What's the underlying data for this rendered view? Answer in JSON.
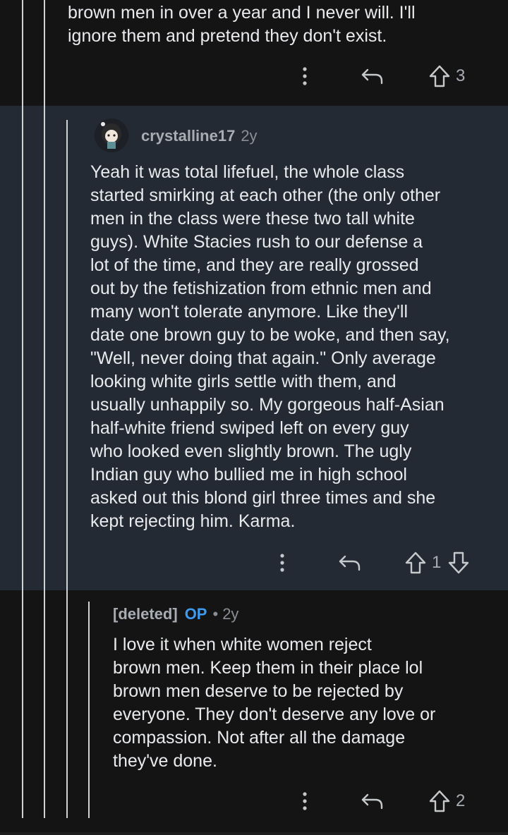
{
  "comment_top": {
    "text_partial": "brown men in over a year and I never will. I'll\nignore them and pretend they don't exist.",
    "upvotes": "3"
  },
  "comment_reply": {
    "username": "crystalline17",
    "time": "2y",
    "text": "Yeah it was total lifefuel, the whole class\nstarted smirking at each other (the only other\nmen in the class were these two tall white\nguys). White Stacies rush to our defense a\nlot of the time, and they are really grossed\nout by the fetishization from ethnic men and\nmany won't tolerate anymore. Like they'll\ndate one brown guy to be woke, and then say,\n\"Well, never doing that again.\" Only average\nlooking white girls settle with them, and\nusually unhappily so. My gorgeous half-Asian\nhalf-white friend swiped left on every guy\nwho looked even slightly brown. The ugly\nIndian guy who bullied me in high school\nasked out this blond girl three times and she\nkept rejecting him. Karma.",
    "upvotes": "1"
  },
  "comment_op": {
    "username": "[deleted]",
    "op_label": "OP",
    "separator": "•",
    "time": "2y",
    "text": "I love it when white women reject\nbrown men. Keep them in their place lol\nbrown men deserve to be rejected by\neveryone. They don't deserve any love or\ncompassion. Not after all the damage\nthey've done.",
    "upvotes": "2"
  },
  "icons": [
    "more-options-icon",
    "reply-icon",
    "upvote-icon",
    "downvote-icon"
  ],
  "colors": {
    "page_bg": "#141414",
    "highlight_bg": "#232a33",
    "thread_line": "#cfd3d6",
    "op_blue": "#3d9bf0",
    "muted_text": "#a8adb3"
  }
}
